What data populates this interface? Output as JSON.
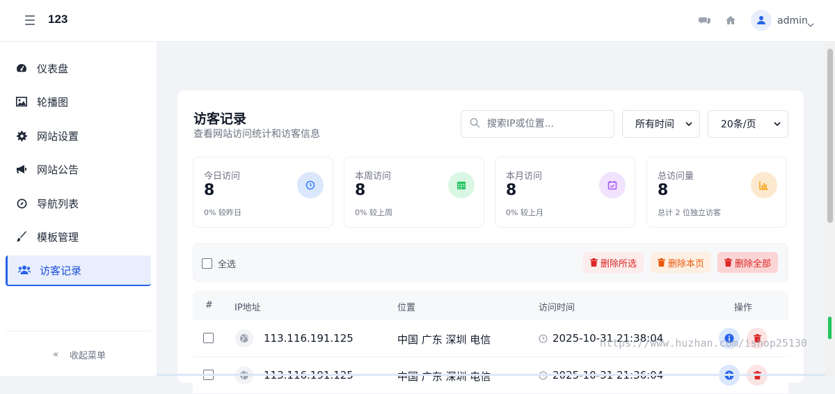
{
  "app": {
    "title": "123"
  },
  "header": {
    "username": "admin"
  },
  "sidebar": {
    "items": [
      {
        "label": "仪表盘",
        "icon": "dashboard-icon"
      },
      {
        "label": "轮播图",
        "icon": "image-icon"
      },
      {
        "label": "网站设置",
        "icon": "gear-icon"
      },
      {
        "label": "网站公告",
        "icon": "megaphone-icon"
      },
      {
        "label": "导航列表",
        "icon": "compass-icon"
      },
      {
        "label": "模板管理",
        "icon": "brush-icon"
      },
      {
        "label": "访客记录",
        "icon": "users-icon",
        "active": true
      }
    ],
    "collapse_label": "收起菜单"
  },
  "page": {
    "title": "访客记录",
    "subtitle": "查看网站访问统计和访客信息",
    "search_placeholder": "搜索IP或位置...",
    "time_filter": "所有时间",
    "page_size": "20条/页"
  },
  "stats": [
    {
      "label": "今日访问",
      "value": "8",
      "note": "0% 较昨日",
      "color": "#3b82f6",
      "icon": "clock-icon"
    },
    {
      "label": "本周访问",
      "value": "8",
      "note": "0% 较上周",
      "color": "#22c55e",
      "icon": "calendar-icon"
    },
    {
      "label": "本月访问",
      "value": "8",
      "note": "0% 较上月",
      "color": "#a855f7",
      "icon": "calendar-check-icon"
    },
    {
      "label": "总访问量",
      "value": "8",
      "note": "总计 2 位独立访客",
      "color": "#f59e0b",
      "icon": "bar-chart-icon"
    }
  ],
  "toolbar": {
    "select_all": "全选",
    "delete_selected": "删除所选",
    "delete_page": "删除本页",
    "delete_all": "删除全部"
  },
  "table": {
    "headers": [
      "#",
      "IP地址",
      "位置",
      "访问时间",
      "操作"
    ],
    "rows": [
      {
        "ip": "113.116.191.125",
        "location": "中国 广东 深圳 电信",
        "time": "2025-10-31 21:38:04"
      },
      {
        "ip": "113.116.191.125",
        "location": "中国 广东 深圳 电信",
        "time": "2025-10-31 21:36:04"
      }
    ]
  },
  "watermark": "https://www.huzhan.com/ishop25130"
}
